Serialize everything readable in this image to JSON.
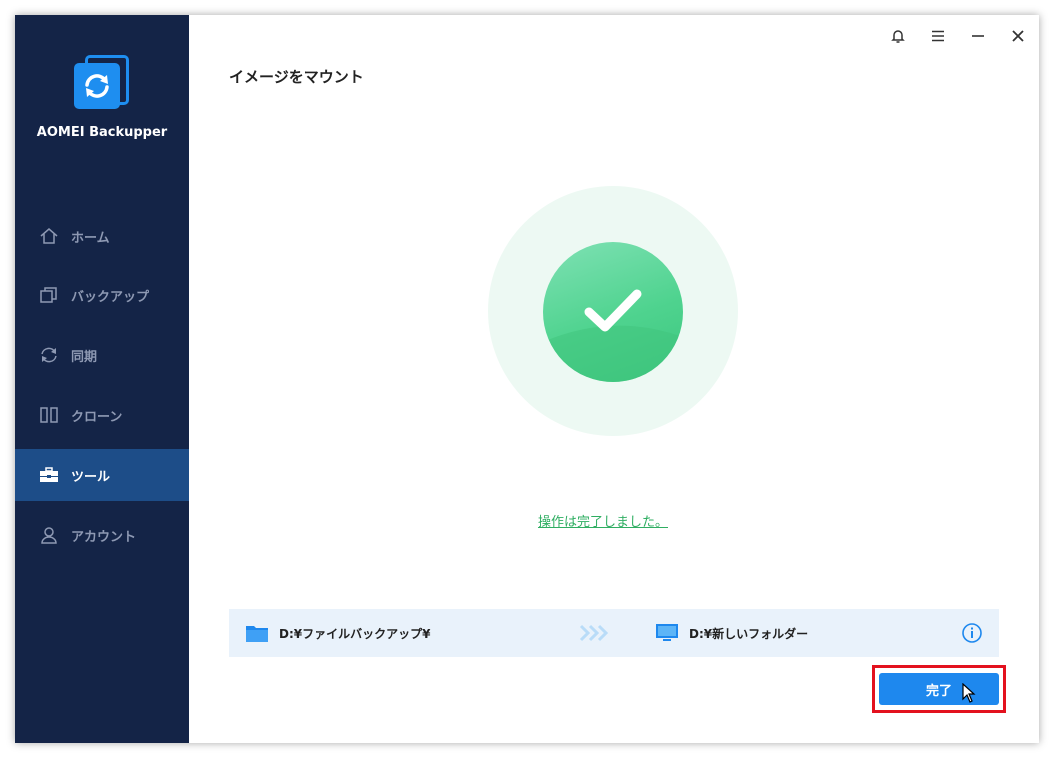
{
  "app": {
    "name": "AOMEI Backupper"
  },
  "sidebar": {
    "items": [
      {
        "label": "ホーム",
        "icon": "home-icon",
        "active": false
      },
      {
        "label": "バックアップ",
        "icon": "backup-icon",
        "active": false
      },
      {
        "label": "同期",
        "icon": "sync-icon",
        "active": false
      },
      {
        "label": "クローン",
        "icon": "clone-icon",
        "active": false
      },
      {
        "label": "ツール",
        "icon": "toolbox-icon",
        "active": true
      },
      {
        "label": "アカウント",
        "icon": "user-icon",
        "active": false
      }
    ]
  },
  "window_controls": [
    "bell-icon",
    "menu-icon",
    "minimize-icon",
    "close-icon"
  ],
  "main": {
    "title": "イメージをマウント",
    "status_icon": "check-icon",
    "status_message": "操作は完了しました。",
    "source_path": "D:¥ファイルバックアップ¥",
    "source_icon": "folder-icon",
    "destination_path": "D:¥新しいフォルダー",
    "destination_icon": "computer-icon",
    "finish_label": "完了"
  },
  "colors": {
    "sidebar_bg": "#142447",
    "sidebar_active": "#1d4d88",
    "accent": "#1e88ee",
    "success": "#3bc67d",
    "highlight": "#e3111e"
  }
}
